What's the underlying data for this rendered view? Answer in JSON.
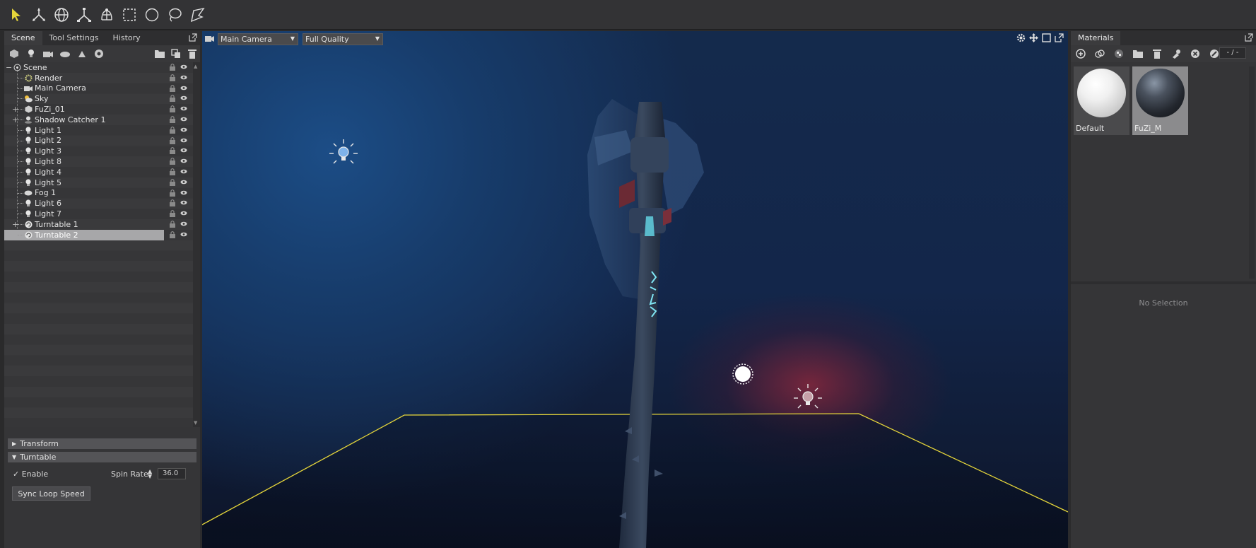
{
  "toolbar": {
    "tools": [
      "select-tool-icon",
      "move-tool-icon",
      "rotate-tool-icon",
      "scale-tool-icon",
      "lasso-brush-icon",
      "rect-select-icon",
      "circle-select-icon",
      "lasso-select-icon",
      "poly-select-icon"
    ]
  },
  "left_panel": {
    "tabs": [
      "Scene",
      "Tool Settings",
      "History"
    ],
    "active_tab": "Scene"
  },
  "scene_tree": {
    "root": "Scene",
    "items": [
      {
        "label": "Render",
        "icon": "render-icon",
        "expandable": false
      },
      {
        "label": "Main Camera",
        "icon": "camera-icon",
        "expandable": false
      },
      {
        "label": "Sky",
        "icon": "sky-icon",
        "expandable": false
      },
      {
        "label": "FuZi_01",
        "icon": "mesh-icon",
        "expandable": true
      },
      {
        "label": "Shadow Catcher 1",
        "icon": "shadow-catcher-icon",
        "expandable": true
      },
      {
        "label": "Light 1",
        "icon": "light-icon",
        "expandable": false
      },
      {
        "label": "Light 2",
        "icon": "light-icon",
        "expandable": false
      },
      {
        "label": "Light 3",
        "icon": "light-icon",
        "expandable": false
      },
      {
        "label": "Light 8",
        "icon": "light-icon",
        "expandable": false
      },
      {
        "label": "Light 4",
        "icon": "light-icon",
        "expandable": false
      },
      {
        "label": "Light 5",
        "icon": "light-icon",
        "expandable": false
      },
      {
        "label": "Fog 1",
        "icon": "fog-icon",
        "expandable": false
      },
      {
        "label": "Light 6",
        "icon": "light-icon",
        "expandable": false
      },
      {
        "label": "Light 7",
        "icon": "light-icon",
        "expandable": false
      },
      {
        "label": "Turntable 1",
        "icon": "turntable-icon",
        "expandable": true
      },
      {
        "label": "Turntable 2",
        "icon": "turntable-icon",
        "expandable": false,
        "selected": true
      }
    ]
  },
  "properties": {
    "transform_label": "Transform",
    "turntable_label": "Turntable",
    "enable_label": "Enable",
    "enable_checked": true,
    "spin_rate_label": "Spin Rate",
    "spin_rate_value": "36.0",
    "sync_button": "Sync Loop Speed"
  },
  "viewport": {
    "camera_select": "Main Camera",
    "quality_select": "Full Quality"
  },
  "materials": {
    "title": "Materials",
    "page": "- / -",
    "items": [
      {
        "name": "Default",
        "selected": false
      },
      {
        "name": "FuZi_M",
        "selected": true
      }
    ],
    "no_selection": "No Selection"
  },
  "colors": {
    "accent_yellow": "#e6d63a",
    "panel": "#353537",
    "selection": "#a7a7a9"
  }
}
